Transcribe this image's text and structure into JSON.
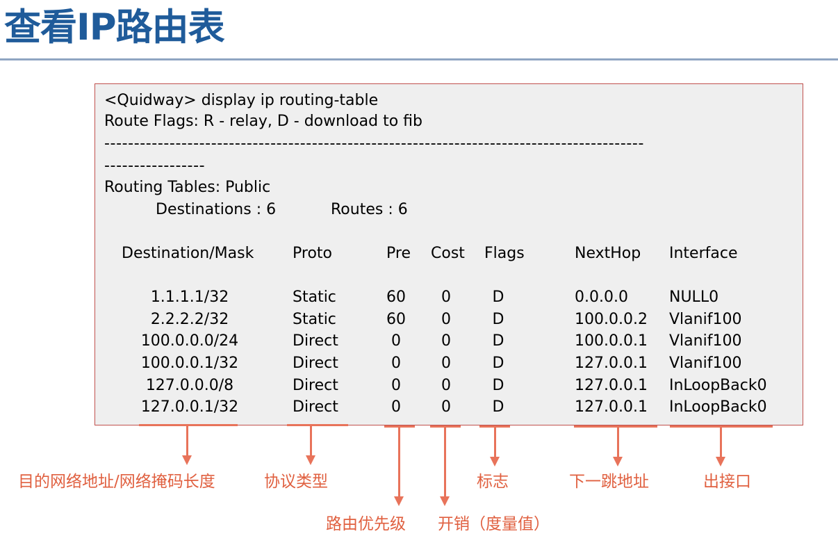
{
  "title": "查看IP路由表",
  "accent_color": "#e8735a",
  "title_color": "#1f5b9a",
  "terminal": {
    "command": "<Quidway> display ip routing-table",
    "flags_line": "Route Flags: R - relay, D - download to fib",
    "dash_line_1": "-------------------------------------------------------------------------------------------",
    "dash_line_2": "-----------------",
    "tables_line": "Routing Tables: Public",
    "destinations": "Destinations : 6",
    "routes": "Routes : 6"
  },
  "table": {
    "headers": [
      "Destination/Mask",
      "Proto",
      "Pre",
      "Cost",
      "Flags",
      "NextHop",
      "Interface"
    ],
    "rows": [
      [
        "1.1.1.1/32",
        "Static",
        "60",
        "0",
        "D",
        "0.0.0.0",
        "NULL0"
      ],
      [
        "2.2.2.2/32",
        "Static",
        "60",
        "0",
        "D",
        "100.0.0.2",
        "Vlanif100"
      ],
      [
        "100.0.0.0/24",
        "Direct",
        "0",
        "0",
        "D",
        "100.0.0.1",
        "Vlanif100"
      ],
      [
        "100.0.0.1/32",
        "Direct",
        "0",
        "0",
        "D",
        "127.0.0.1",
        "Vlanif100"
      ],
      [
        "127.0.0.0/8",
        "Direct",
        "0",
        "0",
        "D",
        "127.0.0.1",
        "InLoopBack0"
      ],
      [
        "127.0.0.1/32",
        "Direct",
        "0",
        "0",
        "D",
        "127.0.0.1",
        "InLoopBack0"
      ]
    ]
  },
  "annotations": {
    "destination": "目的网络地址/网络掩码长度",
    "proto": "协议类型",
    "pre": "路由优先级",
    "cost": "开销（度量值）",
    "flags": "标志",
    "nexthop": "下一跳地址",
    "interface": "出接口"
  }
}
